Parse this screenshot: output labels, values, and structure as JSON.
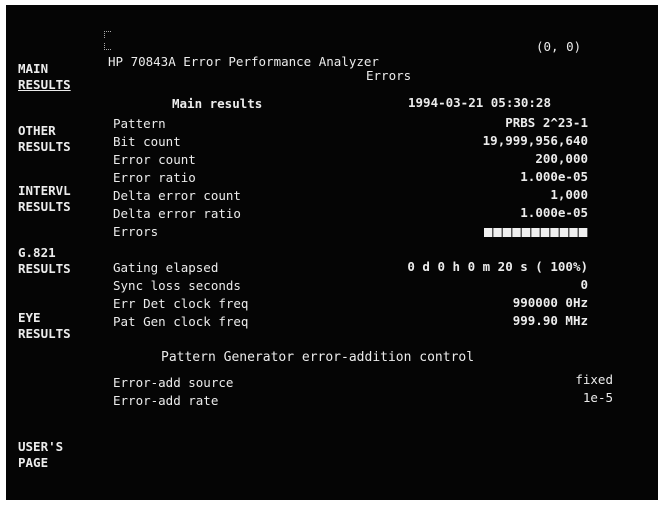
{
  "header": {
    "instrument": "HP 70843A Error Performance Analyzer",
    "screen_title": "Errors",
    "coords": "(0, 0)"
  },
  "softkeys": [
    {
      "line1": "MAIN",
      "line2": "RESULTS"
    },
    {
      "line1": "OTHER",
      "line2": "RESULTS"
    },
    {
      "line1": "INTERVL",
      "line2": "RESULTS"
    },
    {
      "line1": "G.821",
      "line2": "RESULTS"
    },
    {
      "line1": "EYE",
      "line2": "RESULTS"
    },
    {
      "line1": "USER'S",
      "line2": "PAGE"
    }
  ],
  "main_results": {
    "heading": "Main results",
    "timestamp": "1994-03-21 05:30:28",
    "rows": [
      {
        "label": "Pattern",
        "value": "PRBS 2^23-1"
      },
      {
        "label": "Bit count",
        "value": "19,999,956,640"
      },
      {
        "label": "Error count",
        "value": "200,000"
      },
      {
        "label": "Error ratio",
        "value": "1.000e-05"
      },
      {
        "label": "Delta error count",
        "value": "1,000"
      },
      {
        "label": "Delta error ratio",
        "value": "1.000e-05"
      },
      {
        "label": "Errors",
        "value": ""
      }
    ]
  },
  "gating": {
    "rows": [
      {
        "label": "Gating elapsed",
        "value": "0 d  0 h  0 m 20 s ( 100%)"
      },
      {
        "label": "Sync loss seconds",
        "value": "0"
      },
      {
        "label": "Err Det clock freq",
        "value": "990000 0Hz"
      },
      {
        "label": "Pat Gen clock freq",
        "value": "999.90 MHz"
      }
    ]
  },
  "error_add": {
    "heading": "Pattern Generator error-addition control",
    "rows": [
      {
        "label": "Error-add source",
        "value": "fixed"
      },
      {
        "label": "Error-add rate",
        "value": "1e-5"
      }
    ]
  }
}
